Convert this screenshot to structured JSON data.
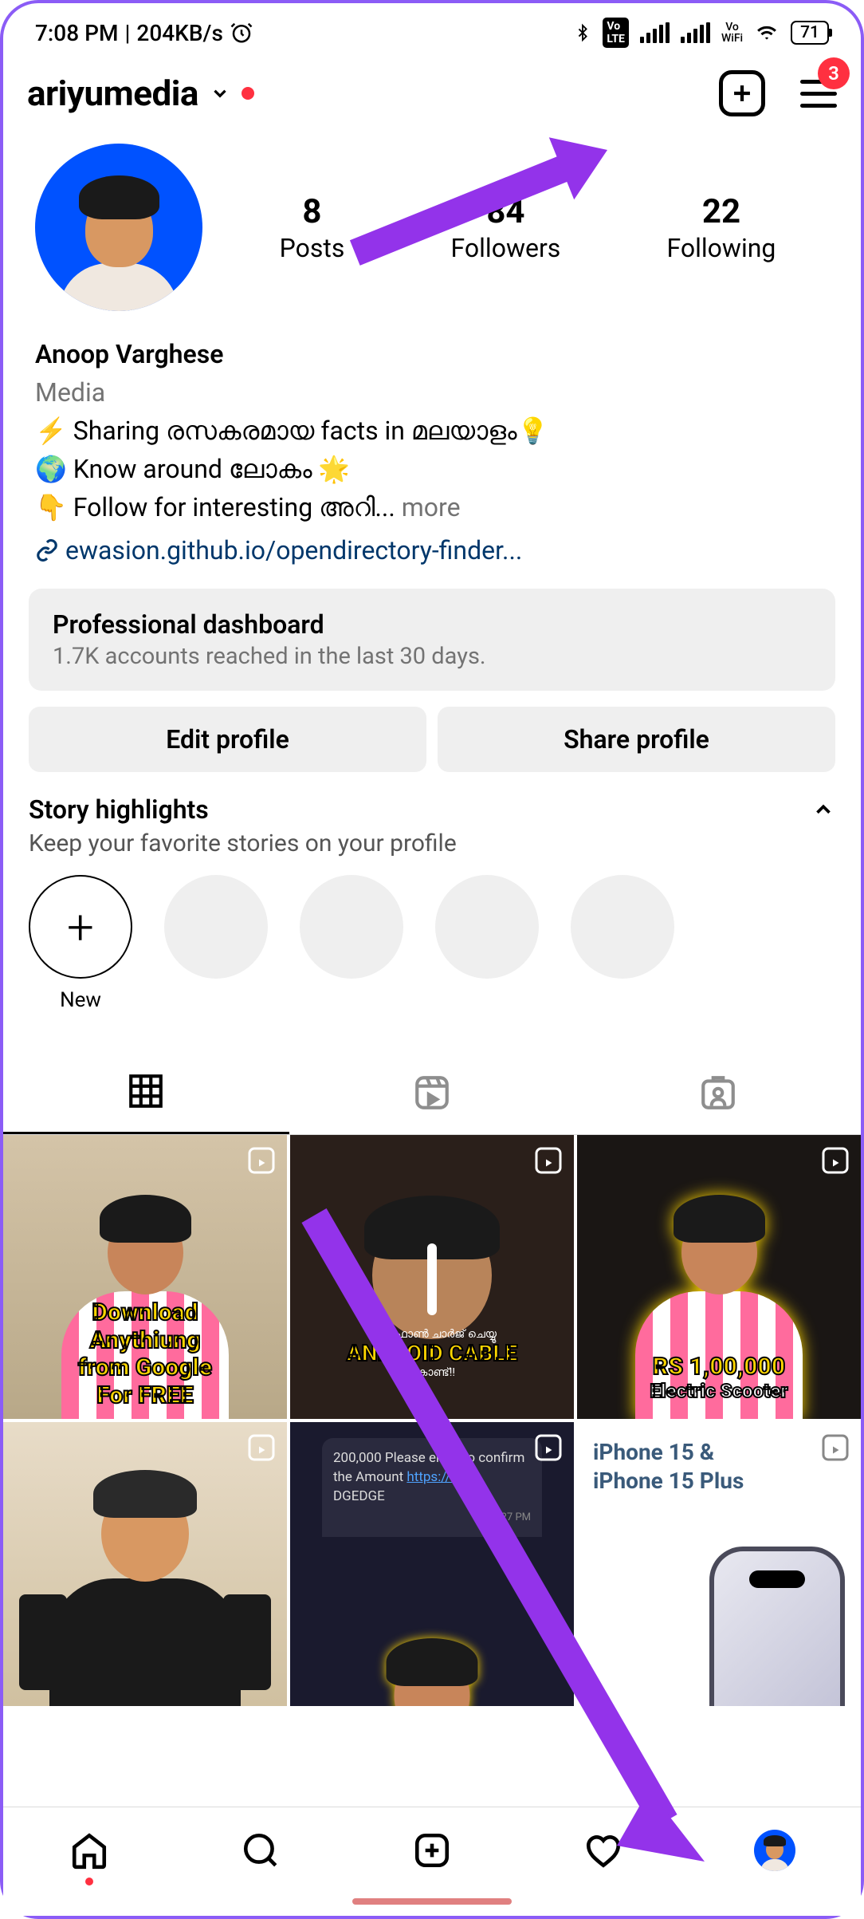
{
  "status": {
    "time": "7:08 PM",
    "speed": "204KB/s",
    "battery": "71"
  },
  "header": {
    "username": "ariyumedia",
    "badge": "3"
  },
  "stats": {
    "posts": {
      "num": "8",
      "label": "Posts"
    },
    "followers": {
      "num": "84",
      "label": "Followers"
    },
    "following": {
      "num": "22",
      "label": "Following"
    }
  },
  "bio": {
    "name": "Anoop Varghese",
    "category": "Media",
    "line1": "⚡ Sharing രസകരമായ facts in മലയാളം💡",
    "line2": "🌍 Know around ലോകം 🌟",
    "line3": "👇 Follow for interesting അറി...",
    "more": " more",
    "link": "ewasion.github.io/opendirectory-finder..."
  },
  "dashboard": {
    "title": "Professional dashboard",
    "sub": "1.7K accounts reached in the last 30 days."
  },
  "actions": {
    "edit": "Edit profile",
    "share": "Share profile"
  },
  "highlights": {
    "title": "Story highlights",
    "sub": "Keep your favorite stories on your profile",
    "new": "New"
  },
  "posts": {
    "p1": "Download\nAnythiung\nfrom Google\nFor FREE",
    "p2_sub": "ഐഫോൺ ചാർജ് ചെയ്യൂ",
    "p2_main": "ANDROID CABLE",
    "p2_sub2": "കൊണ്ട്!!",
    "p3_main": "RS 1,00,000",
    "p3_sub": "Electric Scooter",
    "p5_text": "200,000 Please enter to confirm the Amount",
    "p5_link": "https://bit.ly",
    "p5_end": "DGEDGE",
    "p5_time": "12:27 PM",
    "p6_line1": "iPhone 15 &",
    "p6_line2": "iPhone 15 Plus"
  }
}
